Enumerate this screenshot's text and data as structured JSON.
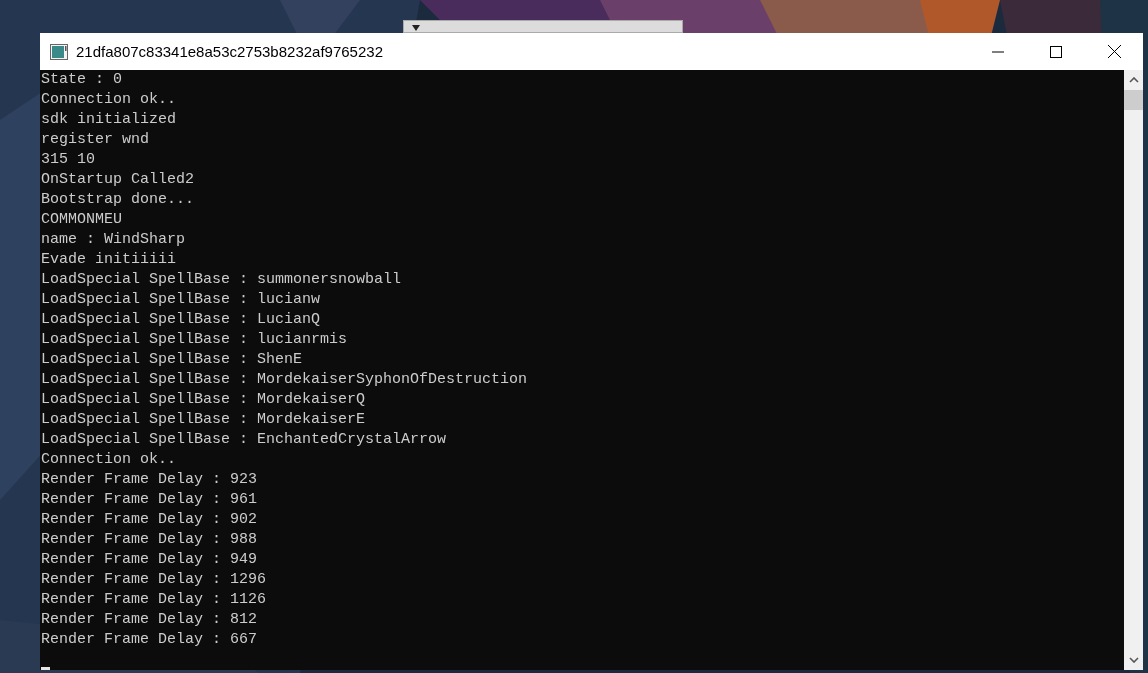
{
  "window": {
    "title": "21dfa807c83341e8a53c2753b8232af9765232"
  },
  "console": {
    "lines": [
      "State : 0",
      "Connection ok..",
      "sdk initialized",
      "register wnd",
      "315 10",
      "OnStartup Called2",
      "Bootstrap done...",
      "COMMONMEU",
      "name : WindSharp",
      "Evade initiiiii",
      "LoadSpecial SpellBase : summonersnowball",
      "LoadSpecial SpellBase : lucianw",
      "LoadSpecial SpellBase : LucianQ",
      "LoadSpecial SpellBase : lucianrmis",
      "LoadSpecial SpellBase : ShenE",
      "LoadSpecial SpellBase : MordekaiserSyphonOfDestruction",
      "LoadSpecial SpellBase : MordekaiserQ",
      "LoadSpecial SpellBase : MordekaiserE",
      "LoadSpecial SpellBase : EnchantedCrystalArrow",
      "Connection ok..",
      "Render Frame Delay : 923",
      "Render Frame Delay : 961",
      "Render Frame Delay : 902",
      "Render Frame Delay : 988",
      "Render Frame Delay : 949",
      "Render Frame Delay : 1296",
      "Render Frame Delay : 1126",
      "Render Frame Delay : 812",
      "Render Frame Delay : 667"
    ]
  }
}
